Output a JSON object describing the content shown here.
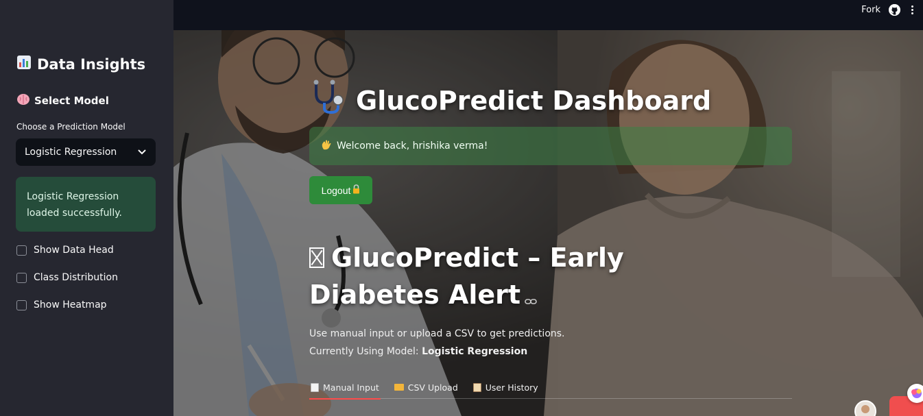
{
  "sidebar": {
    "title_icon": "bar-chart-emoji",
    "title": "Data Insights",
    "select_model_icon": "brain-emoji",
    "select_model_label": "Select Model",
    "choose_label": "Choose a Prediction Model",
    "selected_model": "Logistic Regression",
    "success_message": "Logistic Regression loaded successfully.",
    "checkboxes": [
      {
        "label": "Show Data Head",
        "checked": false
      },
      {
        "label": "Class Distribution",
        "checked": false
      },
      {
        "label": "Show Heatmap",
        "checked": false
      }
    ]
  },
  "topbar": {
    "fork_label": "Fork",
    "github_icon": "github-icon",
    "menu_icon": "kebab-menu-icon"
  },
  "main": {
    "dashboard_title": "GlucoPredict Dashboard",
    "dashboard_icon": "stethoscope-emoji",
    "welcome_icon": "waving-hand-emoji",
    "welcome_text": "Welcome back, hrishika verma!",
    "logout_label": "Logout",
    "logout_icon": "lock-emoji",
    "app_title": "GlucoPredict – Early Diabetes Alert",
    "intro_text": "Use manual input or upload a CSV to get predictions.",
    "model_prefix": "Currently Using Model: ",
    "model_name": "Logistic Regression",
    "tabs": [
      {
        "label": "Manual Input",
        "icon": "memo-emoji",
        "active": true
      },
      {
        "label": "CSV Upload",
        "icon": "folder-emoji",
        "active": false
      },
      {
        "label": "User History",
        "icon": "scroll-emoji",
        "active": false
      }
    ]
  },
  "colors": {
    "sidebar_bg": "#262730",
    "app_bg": "#0e1117",
    "success_bg": "#254c3a",
    "logout_bg": "#2e8b3a",
    "tab_accent": "#ff4b4b"
  }
}
